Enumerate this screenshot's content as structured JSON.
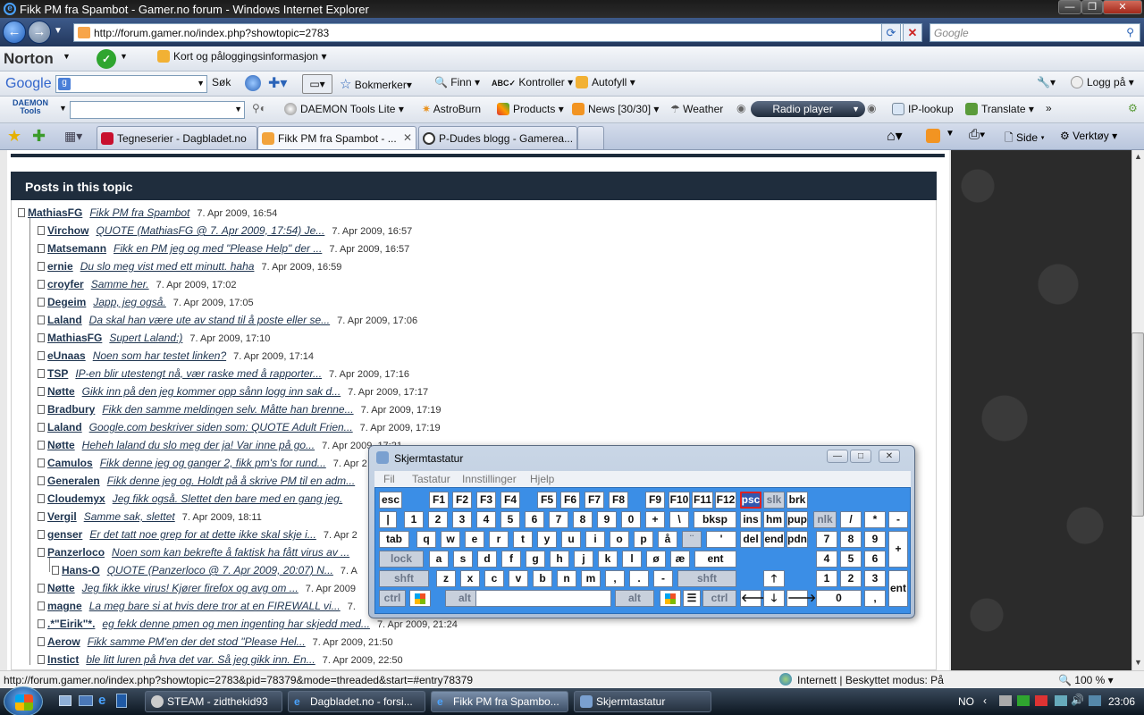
{
  "window": {
    "title": "Fikk PM fra Spambot - Gamer.no forum - Windows Internet Explorer"
  },
  "address": {
    "url": "http://forum.gamer.no/index.php?showtopic=2783",
    "search_placeholder": "Google"
  },
  "norton": {
    "brand": "Norton",
    "cards_label": "Kort og påloggingsinformasjon"
  },
  "google": {
    "brand": "Google",
    "search_btn": "Søk",
    "bookmarks": "Bokmerker",
    "find": "Finn",
    "check": "Kontroller",
    "autofill": "Autofyll",
    "login": "Logg på"
  },
  "daemon": {
    "brand": "DAEMON Tools",
    "lite": "DAEMON Tools Lite",
    "astroburn": "AstroBurn",
    "products": "Products",
    "news": "News [30/30]",
    "weather": "Weather",
    "radio": "Radio player",
    "iplookup": "IP-lookup",
    "translate": "Translate"
  },
  "tabs": [
    {
      "label": "Tegneserier - Dagbladet.no"
    },
    {
      "label": "Fikk PM fra Spambot - ..."
    },
    {
      "label": "P-Dudes blogg - Gamerea..."
    }
  ],
  "cmdbar": {
    "side": "Side",
    "tools": "Verktøy"
  },
  "panel": {
    "title": "Posts in this topic"
  },
  "posts": [
    {
      "author": "MathiasFG",
      "subject": "Fikk PM fra Spambot",
      "date": "7. Apr 2009, 16:54"
    },
    {
      "author": "Virchow",
      "subject": "QUOTE (MathiasFG @ 7. Apr 2009, 17:54) Je...",
      "date": "7. Apr 2009, 16:57"
    },
    {
      "author": "Matsemann",
      "subject": "Fikk en PM jeg og med \"Please Help\" der ...",
      "date": "7. Apr 2009, 16:57"
    },
    {
      "author": "ernie",
      "subject": "Du slo meg vist med ett minutt. haha",
      "date": "7. Apr 2009, 16:59"
    },
    {
      "author": "croyfer",
      "subject": "Samme her.",
      "date": "7. Apr 2009, 17:02"
    },
    {
      "author": "Degeim",
      "subject": "Japp, jeg også.",
      "date": "7. Apr 2009, 17:05"
    },
    {
      "author": "Laland",
      "subject": "Da skal han være ute av stand til å poste eller se...",
      "date": "7. Apr 2009, 17:06"
    },
    {
      "author": "MathiasFG",
      "subject": "Supert Laland:)",
      "date": "7. Apr 2009, 17:10"
    },
    {
      "author": "eUnaas",
      "subject": "Noen som har testet linken?",
      "date": "7. Apr 2009, 17:14"
    },
    {
      "author": "TSP",
      "subject": "IP-en blir utestengt nå, vær raske med å rapporter...",
      "date": "7. Apr 2009, 17:16"
    },
    {
      "author": "Nøtte",
      "subject": "Gikk inn på den jeg kommer opp sånn logg inn sak d...",
      "date": "7. Apr 2009, 17:17"
    },
    {
      "author": "Bradbury",
      "subject": "Fikk den samme meldingen selv. Måtte han brenne...",
      "date": "7. Apr 2009, 17:19"
    },
    {
      "author": "Laland",
      "subject": "Google.com beskriver siden som: QUOTE Adult Frien...",
      "date": "7. Apr 2009, 17:19"
    },
    {
      "author": "Nøtte",
      "subject": "Heheh laland du slo meg der ja! Var inne på go...",
      "date": "7. Apr 2009, 17:21"
    },
    {
      "author": "Camulos",
      "subject": "Fikk denne jeg og ganger 2, fikk pm's for rund...",
      "date": "7. Apr 2"
    },
    {
      "author": "Generalen",
      "subject": "Fikk denne jeg og. Holdt på å skrive PM til en adm...",
      "date": ""
    },
    {
      "author": "Cloudemyx",
      "subject": "Jeg fikk også. Slettet den bare med en gang jeg.",
      "date": ""
    },
    {
      "author": "Vergil",
      "subject": "Samme sak, slettet",
      "date": "7. Apr 2009, 18:11"
    },
    {
      "author": "genser",
      "subject": "Er det tatt noe grep for at dette ikke skal skje i...",
      "date": "7. Apr 2"
    },
    {
      "author": "Panzerloco",
      "subject": "Noen som kan bekrefte å faktisk ha fått virus av ...",
      "date": ""
    },
    {
      "author": "Hans-O",
      "subject": "QUOTE (Panzerloco @ 7. Apr 2009, 20:07) N...",
      "date": "7. A"
    },
    {
      "author": "Nøtte",
      "subject": "Jeg fikk ikke virus! Kjører firefox og avg om ...",
      "date": "7. Apr 2009"
    },
    {
      "author": "magne",
      "subject": "La meg bare si at hvis dere tror at en FIREWALL vi...",
      "date": "7."
    },
    {
      "author": ".*\"Eirik\"*.",
      "subject": "eg fekk denne pmen og men ingenting har skjedd med...",
      "date": "7. Apr 2009, 21:24"
    },
    {
      "author": "Aerow",
      "subject": "Fikk samme PM'en der det stod \"Please Hel...",
      "date": "7. Apr 2009, 21:50"
    },
    {
      "author": "Instict",
      "subject": "ble litt luren på hva det var. Så jeg gikk inn. En...",
      "date": "7. Apr 2009, 22:50"
    }
  ],
  "osk": {
    "title": "Skjermtastatur",
    "menu": [
      "Fil",
      "Tastatur",
      "Innstillinger",
      "Hjelp"
    ],
    "keys": {
      "esc": "esc",
      "f1": "F1",
      "f2": "F2",
      "f3": "F3",
      "f4": "F4",
      "f5": "F5",
      "f6": "F6",
      "f7": "F7",
      "f8": "F8",
      "f9": "F9",
      "f10": "F10",
      "f11": "F11",
      "f12": "F12",
      "psc": "psc",
      "slk": "slk",
      "brk": "brk",
      "pipe": "|",
      "n1": "1",
      "n2": "2",
      "n3": "3",
      "n4": "4",
      "n5": "5",
      "n6": "6",
      "n7": "7",
      "n8": "8",
      "n9": "9",
      "n0": "0",
      "plus": "+",
      "bslash": "\\",
      "bksp": "bksp",
      "ins": "ins",
      "hm": "hm",
      "pup": "pup",
      "nlk": "nlk",
      "div": "/",
      "mul": "*",
      "sub": "-",
      "tab": "tab",
      "q": "q",
      "w": "w",
      "e": "e",
      "r": "r",
      "t": "t",
      "y": "y",
      "u": "u",
      "i": "i",
      "o": "o",
      "p": "p",
      "aa": "å",
      "diaer": "¨",
      "apos": "'",
      "del": "del",
      "end": "end",
      "pdn": "pdn",
      "np7": "7",
      "np8": "8",
      "np9": "9",
      "npplus": "+",
      "lock": "lock",
      "a": "a",
      "s": "s",
      "d": "d",
      "f": "f",
      "g": "g",
      "h": "h",
      "j": "j",
      "k": "k",
      "l": "l",
      "oe": "ø",
      "ae": "æ",
      "ent": "ent",
      "np4": "4",
      "np5": "5",
      "np6": "6",
      "shft": "shft",
      "z": "z",
      "x": "x",
      "c": "c",
      "v": "v",
      "b": "b",
      "n": "n",
      "m": "m",
      "comma": ",",
      "dot": ".",
      "dash": "-",
      "up": "🡑",
      "np1": "1",
      "np2": "2",
      "np3": "3",
      "npent": "ent",
      "ctrl": "ctrl",
      "alt": "alt",
      "left": "🡐",
      "down": "🡓",
      "right": "🡒",
      "np0": "0",
      "npdot": ","
    }
  },
  "status": {
    "url": "http://forum.gamer.no/index.php?showtopic=2783&pid=78379&mode=threaded&start=#entry78379",
    "zone": "Internett | Beskyttet modus: På",
    "zoom": "100 %"
  },
  "taskbar": {
    "items": [
      {
        "label": "STEAM - zidthekid93"
      },
      {
        "label": "Dagbladet.no - forsi..."
      },
      {
        "label": "Fikk PM fra Spambo..."
      },
      {
        "label": "Skjermtastatur"
      }
    ],
    "lang": "NO",
    "time": "23:06"
  }
}
